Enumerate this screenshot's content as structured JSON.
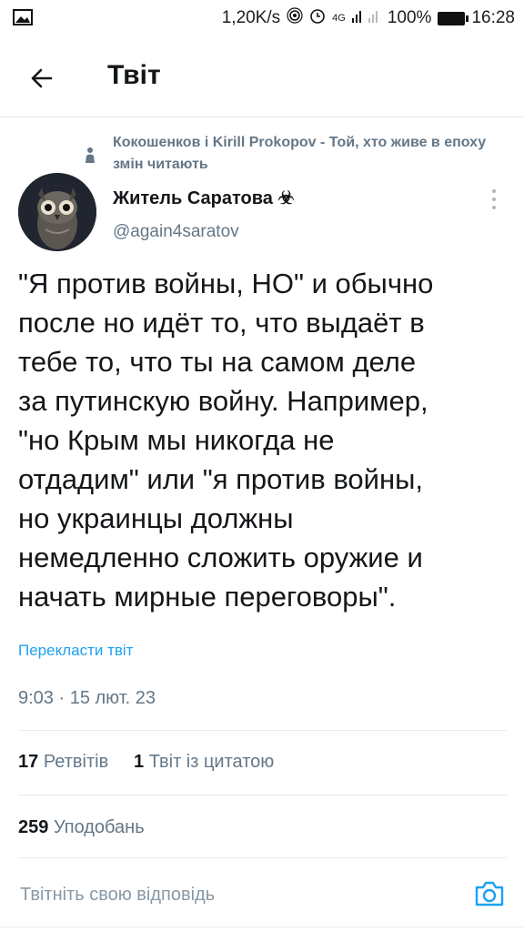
{
  "status": {
    "speed": "1,20K/s",
    "network": "4G",
    "battery": "100%",
    "time": "16:28"
  },
  "header": {
    "title": "Твіт"
  },
  "tweet": {
    "social_context": "Кокошенков і Kirill Prokopov - Той, хто живе в епоху змін читають",
    "display_name": "Житель Саратова ☣",
    "handle": "@again4saratov",
    "text": "\"Я против войны, НО\" и обычно\nпосле но идёт то, что выдаёт в\nтебе то, что ты на самом деле\nза путинскую войну. Например,\n\"но Крым мы никогда не\nотдадим\" или \"я против войны,\nно украинцы должны\nнемедленно сложить оружие и\nначать мирные переговоры\".",
    "translate": "Перекласти твіт",
    "timestamp": "9:03 · 15 лют. 23",
    "retweets_count": "17",
    "retweets_label": "Ретвітів",
    "quotes_count": "1",
    "quotes_label": "Твіт із цитатою",
    "likes_count": "259",
    "likes_label": "Уподобань"
  },
  "reply": {
    "placeholder": "Твітніть свою відповідь"
  },
  "colors": {
    "accent": "#1da1f2",
    "muted": "#657786",
    "divider": "#e6ecf0"
  }
}
